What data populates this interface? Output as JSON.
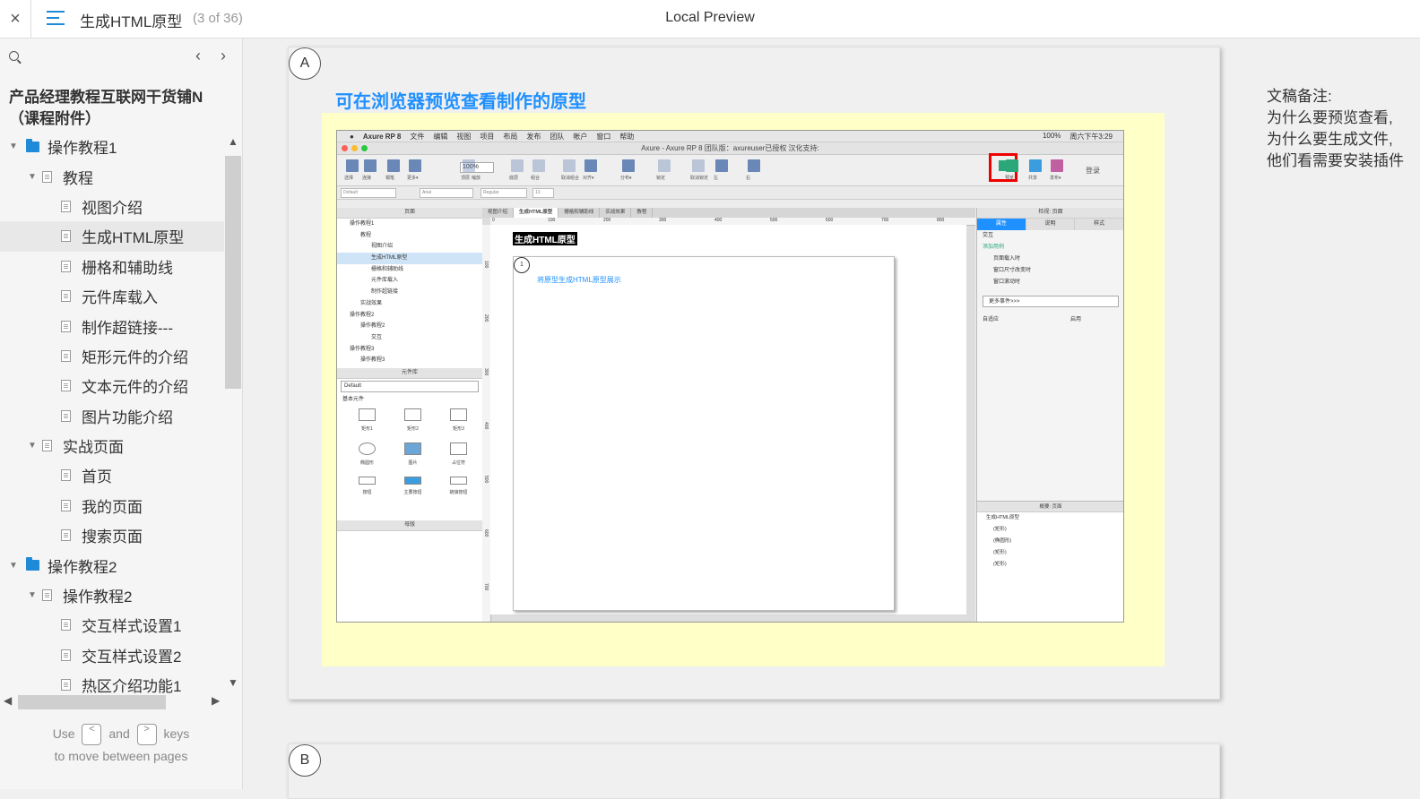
{
  "topbar": {
    "close_label": "×",
    "page_title": "生成HTML原型",
    "page_count": "(3 of 36)",
    "app_title": "Local Preview"
  },
  "sidebar": {
    "prev_label": "‹",
    "next_label": "›",
    "project_title": "产品经理教程互联网干货铺N（课程附件）",
    "tree": [
      {
        "label": "操作教程1",
        "type": "folder",
        "level": 0,
        "expanded": true
      },
      {
        "label": "教程",
        "type": "page",
        "level": 1,
        "expanded": true
      },
      {
        "label": "视图介绍",
        "type": "page",
        "level": 2
      },
      {
        "label": "生成HTML原型",
        "type": "page",
        "level": 2,
        "selected": true
      },
      {
        "label": "栅格和辅助线",
        "type": "page",
        "level": 2
      },
      {
        "label": "元件库载入",
        "type": "page",
        "level": 2
      },
      {
        "label": "制作超链接---",
        "type": "page",
        "level": 2
      },
      {
        "label": "矩形元件的介绍",
        "type": "page",
        "level": 2
      },
      {
        "label": "文本元件的介绍",
        "type": "page",
        "level": 2
      },
      {
        "label": "图片功能介绍",
        "type": "page",
        "level": 2
      },
      {
        "label": "实战页面",
        "type": "page",
        "level": 1,
        "expanded": true
      },
      {
        "label": "首页",
        "type": "page",
        "level": 2
      },
      {
        "label": "我的页面",
        "type": "page",
        "level": 2
      },
      {
        "label": "搜索页面",
        "type": "page",
        "level": 2
      },
      {
        "label": "操作教程2",
        "type": "folder",
        "level": 0,
        "expanded": true
      },
      {
        "label": "操作教程2",
        "type": "page",
        "level": 1,
        "expanded": true
      },
      {
        "label": "交互样式设置1",
        "type": "page",
        "level": 2
      },
      {
        "label": "交互样式设置2",
        "type": "page",
        "level": 2
      },
      {
        "label": "热区介绍功能1",
        "type": "page",
        "level": 2
      }
    ],
    "hint_use": "Use",
    "hint_and": "and",
    "hint_keys": "keys",
    "hint_line2": "to move between pages",
    "key_prev": "<",
    "key_next": ">"
  },
  "content": {
    "badge_a": "A",
    "badge_b": "B",
    "heading": "可在浏览器预览查看制作的原型",
    "notes": [
      "文稿备注:",
      "为什么要预览查看,",
      "为什么要生成文件,",
      "他们看需要安装插件"
    ]
  },
  "mock": {
    "menu": [
      "Axure RP 8",
      "文件",
      "编辑",
      "视图",
      "项目",
      "布局",
      "发布",
      "团队",
      "帐户",
      "窗口",
      "帮助"
    ],
    "menu_right": [
      "100%",
      "周六下午3:29"
    ],
    "window_title": "Axure - Axure RP 8 团队版：axureuser已授权 汉化支持:",
    "toolbar_labels": [
      "选择",
      "连接",
      "钢笔",
      "更多▾",
      "缩放",
      "顶层",
      "底层",
      "组合",
      "取消组合",
      "对齐▾",
      "分布▾",
      "锁定",
      "取消锁定",
      "左",
      "右"
    ],
    "zoom": "100%",
    "toolbar_right": [
      "预览",
      "共享",
      "发布▾",
      "登录"
    ],
    "format": [
      "Default",
      "Arial",
      "Regular",
      "13"
    ],
    "pages_header": "页面",
    "pages_tree": [
      {
        "label": "操作教程1",
        "indent": 0
      },
      {
        "label": "教程",
        "indent": 1
      },
      {
        "label": "视图介绍",
        "indent": 2
      },
      {
        "label": "生成HTML原型",
        "indent": 2,
        "selected": true
      },
      {
        "label": "栅格和辅助线",
        "indent": 2
      },
      {
        "label": "元件库载入",
        "indent": 2
      },
      {
        "label": "制作超链接",
        "indent": 2
      },
      {
        "label": "实战效果",
        "indent": 1
      },
      {
        "label": "操作教程2",
        "indent": 0
      },
      {
        "label": "操作教程2",
        "indent": 1
      },
      {
        "label": "交互",
        "indent": 2
      },
      {
        "label": "操作教程3",
        "indent": 0
      },
      {
        "label": "操作教程3",
        "indent": 1
      }
    ],
    "library_header": "元件库",
    "library_select": "Default",
    "library_group": "基本元件",
    "components": [
      "矩形1",
      "矩形2",
      "矩形3",
      "椭圆形",
      "图片",
      "占位符",
      "按钮",
      "主要按钮",
      "链接按钮"
    ],
    "masters_header": "母版",
    "tabs": [
      "视图介绍",
      "生成HTML原型",
      "栅格和辅助线",
      "实战效果",
      "教程"
    ],
    "ruler_h": [
      "0",
      "100",
      "200",
      "300",
      "400",
      "500",
      "600",
      "700",
      "800"
    ],
    "ruler_v": [
      "100",
      "200",
      "300",
      "400",
      "500",
      "600",
      "700"
    ],
    "canvas_title": "生成HTML原型",
    "canvas_badge": "1",
    "canvas_link": "将原型生成HTML原型展示",
    "inspector_header": "检视: 页面",
    "inspector_tabs": [
      "属性",
      "说明",
      "样式"
    ],
    "interaction_label": "交互",
    "add_case": "添加用例",
    "events": [
      "页面载入时",
      "窗口尺寸改变时",
      "窗口滚动时"
    ],
    "more_events": "更多事件>>>",
    "adaptive": "自适应",
    "enable": "启用",
    "outline_header": "概要: 页面",
    "outline_items": [
      "生成HTML原型",
      "(矩形)",
      "(椭圆形)",
      "(矩形)",
      "(矩形)"
    ]
  }
}
